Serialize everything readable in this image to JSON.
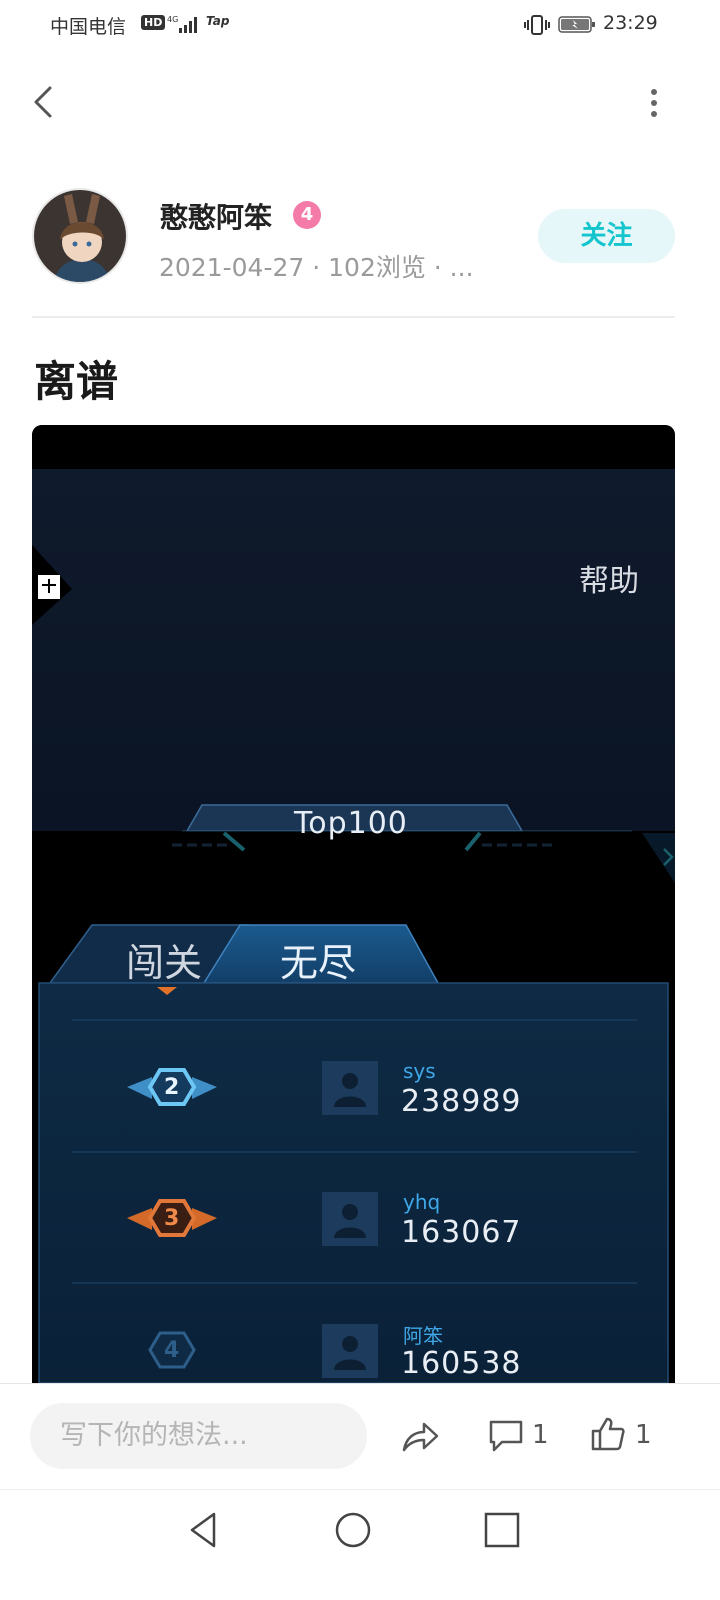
{
  "status_bar": {
    "carrier": "中国电信",
    "hd": "HD",
    "network": "4G",
    "tap": "Tap",
    "time": "23:29"
  },
  "author": {
    "name": "憨憨阿笨",
    "level": "4",
    "meta": "2021-04-27 · 102浏览 · ...",
    "follow_label": "关注"
  },
  "post": {
    "title": "离谱"
  },
  "game_screenshot": {
    "help_label": "帮助",
    "leaderboard_title": "Top100",
    "tabs": [
      "闯关",
      "无尽"
    ],
    "active_tab": "无尽",
    "rows": [
      {
        "rank": "2",
        "name": "sys",
        "score": "238989"
      },
      {
        "rank": "3",
        "name": "yhq",
        "score": "163067"
      },
      {
        "rank": "4",
        "name": "阿笨",
        "score": "160538"
      }
    ]
  },
  "comment_bar": {
    "placeholder": "写下你的想法...",
    "comment_count": "1",
    "like_count": "1"
  },
  "icons": {
    "back": "chevron-left-icon",
    "more": "more-vertical-icon",
    "share": "share-icon",
    "comment": "comment-icon",
    "like": "thumbs-up-icon"
  },
  "colors": {
    "accent": "#15c5ce",
    "follow_bg": "#e5f7f8",
    "level_badge": "#f47aa8",
    "game_bg": "#0b1a2e"
  }
}
